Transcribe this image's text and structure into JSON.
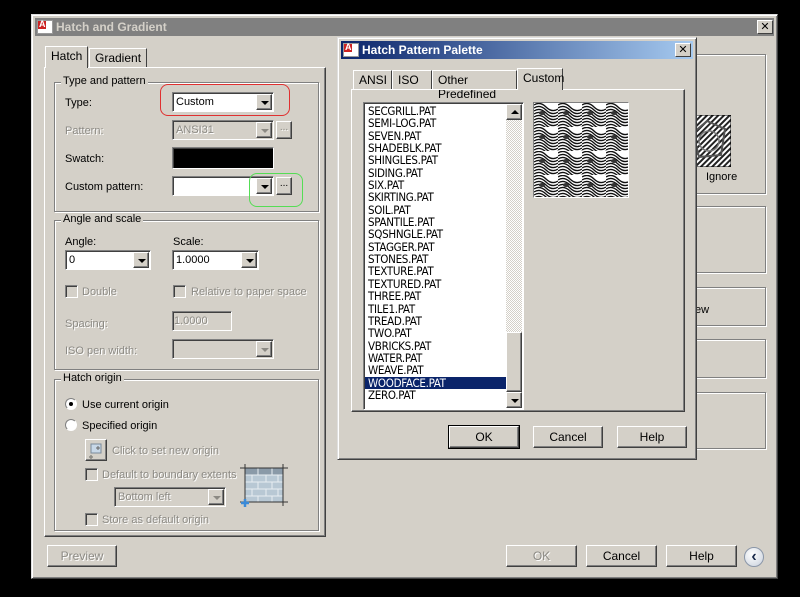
{
  "main_dialog": {
    "title": "Hatch and Gradient",
    "tabs": [
      {
        "label": "Hatch",
        "active": true
      },
      {
        "label": "Gradient",
        "active": false
      }
    ],
    "type_and_pattern": {
      "group_label": "Type and pattern",
      "type_label": "Type:",
      "type_value": "Custom",
      "pattern_label": "Pattern:",
      "pattern_value": "ANSI31",
      "swatch_label": "Swatch:",
      "swatch_color": "#000000",
      "custom_pattern_label": "Custom pattern:",
      "custom_pattern_value": "",
      "ellipsis": "..."
    },
    "angle_and_scale": {
      "group_label": "Angle and scale",
      "angle_label": "Angle:",
      "angle_value": "0",
      "scale_label": "Scale:",
      "scale_value": "1.0000",
      "double_label": "Double",
      "relative_label": "Relative to paper space",
      "spacing_label": "Spacing:",
      "spacing_value": "1.0000",
      "iso_pen_label": "ISO pen width:",
      "iso_pen_value": ""
    },
    "hatch_origin": {
      "group_label": "Hatch origin",
      "use_current_label": "Use current origin",
      "specified_label": "Specified origin",
      "selected": "use_current",
      "click_to_set_label": "Click to set new origin",
      "default_boundary_label": "Default to boundary extents",
      "position_value": "Bottom left",
      "store_default_label": "Store as default origin"
    },
    "right_panel": {
      "island_ignore_label": "Ignore",
      "preview_partial_label": "ew"
    },
    "buttons": {
      "preview": "Preview",
      "ok": "OK",
      "cancel": "Cancel",
      "help": "Help"
    },
    "close_glyph": "✕",
    "collapse_glyph": "‹"
  },
  "palette_dialog": {
    "title": "Hatch Pattern Palette",
    "tabs": [
      {
        "label": "ANSI",
        "active": false
      },
      {
        "label": "ISO",
        "active": false
      },
      {
        "label": "Other Predefined",
        "active": false
      },
      {
        "label": "Custom",
        "active": true
      }
    ],
    "patterns": [
      "SECGRILL.PAT",
      "SEMI-LOG.PAT",
      "SEVEN.PAT",
      "SHADEBLK.PAT",
      "SHINGLES.PAT",
      "SIDING.PAT",
      "SIX.PAT",
      "SKIRTING.PAT",
      "SOIL.PAT",
      "SPANTILE.PAT",
      "SQSHNGLE.PAT",
      "STAGGER.PAT",
      "STONES.PAT",
      "TEXTURE.PAT",
      "TEXTURED.PAT",
      "THREE.PAT",
      "TILE1.PAT",
      "TREAD.PAT",
      "TWO.PAT",
      "VBRICKS.PAT",
      "WATER.PAT",
      "WEAVE.PAT",
      "WOODFACE.PAT",
      "ZERO.PAT"
    ],
    "selected_pattern": "WOODFACE.PAT",
    "buttons": {
      "ok": "OK",
      "cancel": "Cancel",
      "help": "Help"
    },
    "close_glyph": "✕"
  },
  "annotations": {
    "red_highlight_color": "#e03030",
    "green_highlight_color": "#55dd55"
  }
}
